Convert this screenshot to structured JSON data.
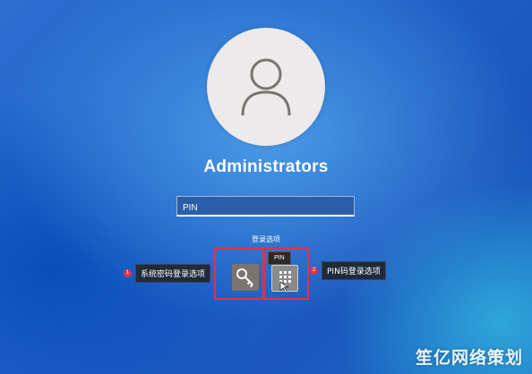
{
  "user": {
    "name": "Administrators",
    "avatar_icon": "person-icon"
  },
  "pin_field": {
    "placeholder": "PIN"
  },
  "sign_in_options": {
    "label": "登录选项",
    "tooltip": "PIN",
    "options": [
      {
        "icon": "key-icon"
      },
      {
        "icon": "pin-keypad-icon"
      }
    ]
  },
  "annotations": [
    {
      "number": "1",
      "text": "系统密码登录选项"
    },
    {
      "number": "2",
      "text": "PIN码登录选项"
    }
  ],
  "watermark": {
    "text": "笙亿网络策划"
  },
  "colors": {
    "highlight": "#e0324a",
    "background": "#1f62c9"
  }
}
